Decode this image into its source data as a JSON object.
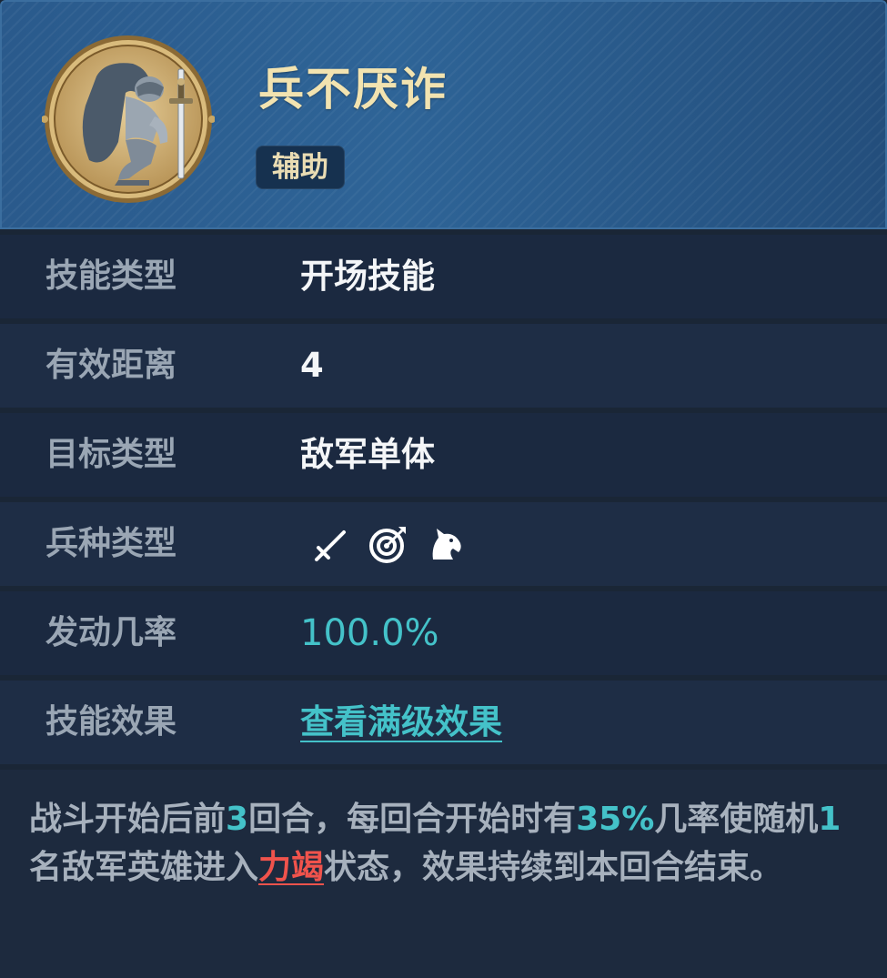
{
  "skill": {
    "name": "兵不厌诈",
    "category": "辅助",
    "portrait": "kneeling-knight-with-sword-portrait"
  },
  "rows": [
    {
      "label": "技能类型",
      "value": "开场技能"
    },
    {
      "label": "有效距离",
      "value": "4"
    },
    {
      "label": "目标类型",
      "value": "敌军单体"
    },
    {
      "label": "兵种类型",
      "icons": [
        "sword-icon",
        "archery-target-icon",
        "horse-head-icon"
      ]
    },
    {
      "label": "发动几率",
      "value": "100.0%"
    },
    {
      "label": "技能效果",
      "value": "查看满级效果"
    }
  ],
  "description": {
    "p1": "战斗开始后前",
    "n1": "3",
    "p2": "回合，每回合开始时有",
    "n2": "35%",
    "p3": "几率使随机",
    "n3": "1",
    "p4": "名敌军英雄进入",
    "status": "力竭",
    "p5": "状态，效果持续到本回合结束。"
  },
  "colors": {
    "accent": "#44c2c9",
    "status": "#f0534c",
    "title": "#f2e3b0"
  }
}
